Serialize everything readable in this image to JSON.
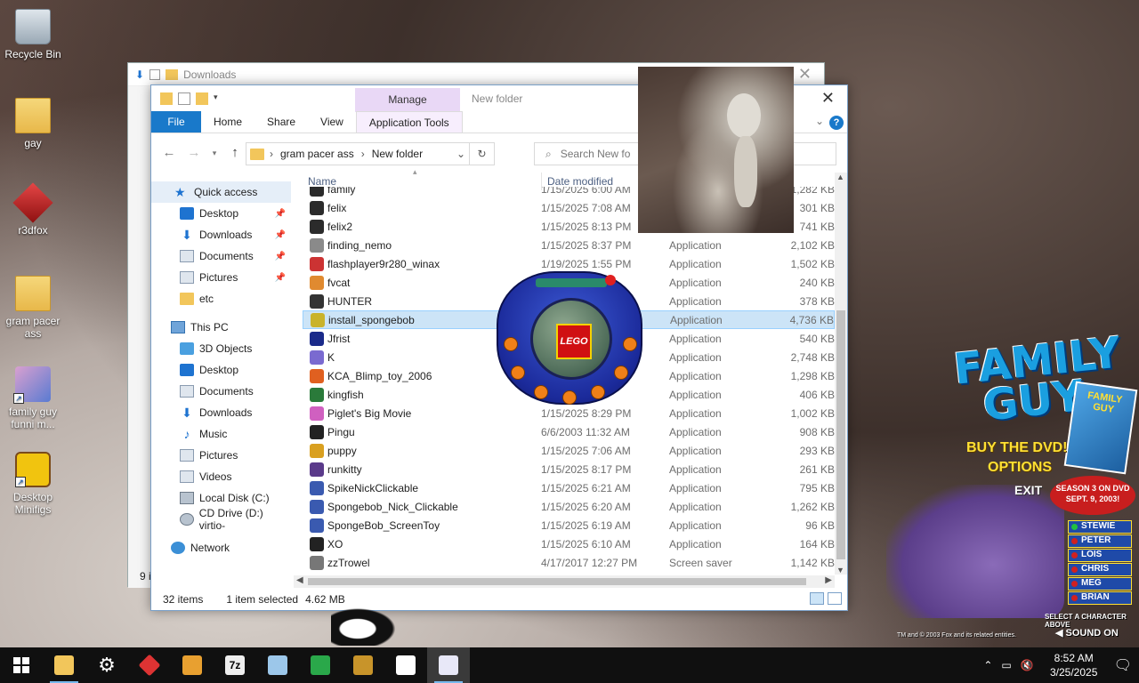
{
  "desktop_icons": [
    {
      "label": "Recycle Bin"
    },
    {
      "label": "gay"
    },
    {
      "label": "r3dfox"
    },
    {
      "label": "gram pacer ass"
    },
    {
      "label": "family guy funni m..."
    },
    {
      "label": "Desktop Minifigs"
    }
  ],
  "back_window": {
    "title": "Downloads",
    "status": "9 i"
  },
  "explorer": {
    "title": "New folder",
    "manage_tab": "Manage",
    "ribbon_tabs": [
      "File",
      "Home",
      "Share",
      "View",
      "Application Tools"
    ],
    "address": {
      "root": "gram pacer ass",
      "current": "New folder"
    },
    "search_placeholder": "Search New fo",
    "columns": {
      "name": "Name",
      "date": "Date modified"
    },
    "nav": [
      {
        "label": "Quick access"
      },
      {
        "label": "Desktop"
      },
      {
        "label": "Downloads"
      },
      {
        "label": "Documents"
      },
      {
        "label": "Pictures"
      },
      {
        "label": "etc"
      },
      {
        "label": "This PC"
      },
      {
        "label": "3D Objects"
      },
      {
        "label": "Desktop"
      },
      {
        "label": "Documents"
      },
      {
        "label": "Downloads"
      },
      {
        "label": "Music"
      },
      {
        "label": "Pictures"
      },
      {
        "label": "Videos"
      },
      {
        "label": "Local Disk (C:)"
      },
      {
        "label": "CD Drive (D:) virtio-"
      },
      {
        "label": "Network"
      }
    ],
    "files": [
      {
        "name": "family",
        "date": "1/15/2025 6:00 AM",
        "type": "",
        "size": "1,282 KB"
      },
      {
        "name": "felix",
        "date": "1/15/2025 7:08 AM",
        "type": "",
        "size": "301 KB"
      },
      {
        "name": "felix2",
        "date": "1/15/2025 8:13 PM",
        "type": "",
        "size": "741 KB"
      },
      {
        "name": "finding_nemo",
        "date": "1/15/2025 8:37 PM",
        "type": "Application",
        "size": "2,102 KB"
      },
      {
        "name": "flashplayer9r280_winax",
        "date": "1/19/2025 1:55 PM",
        "type": "Application",
        "size": "1,502 KB"
      },
      {
        "name": "fvcat",
        "date": "",
        "type": "Application",
        "size": "240 KB"
      },
      {
        "name": "HUNTER",
        "date": "",
        "type": "Application",
        "size": "378 KB"
      },
      {
        "name": "install_spongebob",
        "date": "",
        "type": "Application",
        "size": "4,736 KB"
      },
      {
        "name": "Jfrist",
        "date": "",
        "type": "Application",
        "size": "540 KB"
      },
      {
        "name": "K",
        "date": "",
        "type": "Application",
        "size": "2,748 KB"
      },
      {
        "name": "KCA_Blimp_toy_2006",
        "date": "",
        "type": "Application",
        "size": "1,298 KB"
      },
      {
        "name": "kingfish",
        "date": "AM",
        "type": "Application",
        "size": "406 KB"
      },
      {
        "name": "Piglet's Big Movie",
        "date": "1/15/2025 8:29 PM",
        "type": "Application",
        "size": "1,002 KB"
      },
      {
        "name": "Pingu",
        "date": "6/6/2003 11:32 AM",
        "type": "Application",
        "size": "908 KB"
      },
      {
        "name": "puppy",
        "date": "1/15/2025 7:06 AM",
        "type": "Application",
        "size": "293 KB"
      },
      {
        "name": "runkitty",
        "date": "1/15/2025 8:17 PM",
        "type": "Application",
        "size": "261 KB"
      },
      {
        "name": "SpikeNickClickable",
        "date": "1/15/2025 6:21 AM",
        "type": "Application",
        "size": "795 KB"
      },
      {
        "name": "Spongebob_Nick_Clickable",
        "date": "1/15/2025 6:20 AM",
        "type": "Application",
        "size": "1,262 KB"
      },
      {
        "name": "SpongeBob_ScreenToy",
        "date": "1/15/2025 6:19 AM",
        "type": "Application",
        "size": "96 KB"
      },
      {
        "name": "XO",
        "date": "1/15/2025 6:10 AM",
        "type": "Application",
        "size": "164 KB"
      },
      {
        "name": "zzTrowel",
        "date": "4/17/2017 12:27 PM",
        "type": "Screen saver",
        "size": "1,142 KB"
      }
    ],
    "selected_index": 7,
    "status": {
      "count": "32 items",
      "selection": "1 item selected",
      "size": "4.62 MB"
    }
  },
  "family_guy_ad": {
    "title": "FAMILY GUY",
    "buy": "BUY THE DVD!",
    "options": "OPTIONS",
    "exit": "EXIT",
    "season": "SEASON 3 ON DVD SEPT. 9, 2003!",
    "dvd_label": "FAMILY GUY",
    "characters": [
      "STEWIE",
      "PETER",
      "LOIS",
      "CHRIS",
      "MEG",
      "BRIAN"
    ],
    "select_text": "SELECT A CHARACTER ABOVE",
    "copyright": "TM and © 2003 Fox and its related entities.",
    "sound": "SOUND ON"
  },
  "lego_widget": {
    "logo": "LEGO"
  },
  "taskbar": {
    "time": "8:52 AM",
    "date": "3/25/2025"
  }
}
